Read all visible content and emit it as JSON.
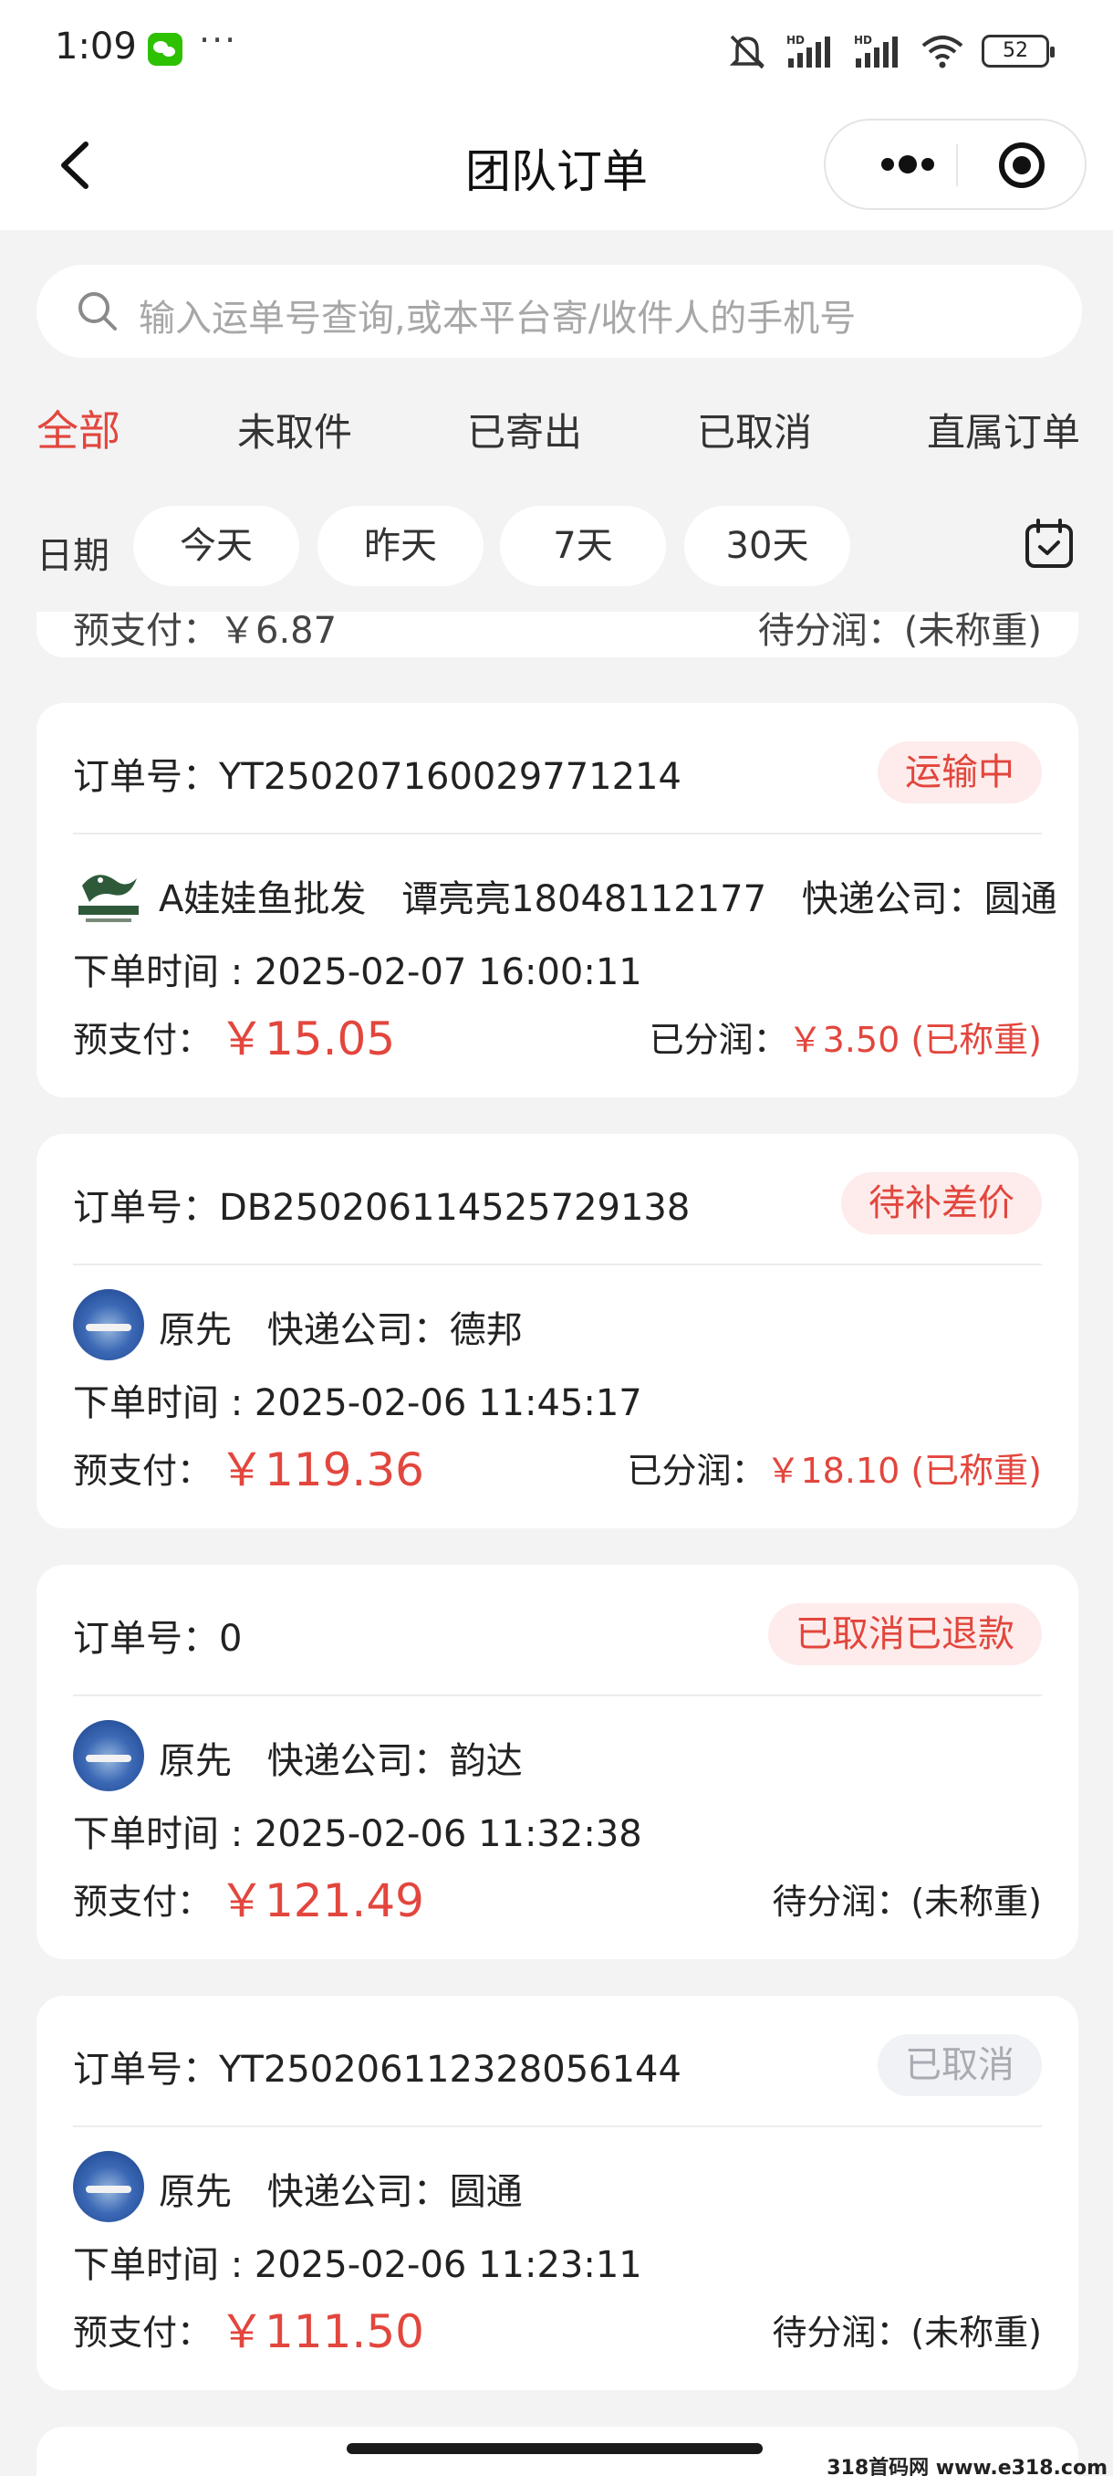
{
  "status_bar": {
    "time": "1:09",
    "more": "···",
    "battery": "52",
    "hd": "HD"
  },
  "nav": {
    "title": "团队订单"
  },
  "search": {
    "placeholder": "输入运单号查询,或本平台寄/收件人的手机号"
  },
  "tabs": [
    {
      "label": "全部",
      "active": true
    },
    {
      "label": "未取件",
      "active": false
    },
    {
      "label": "已寄出",
      "active": false
    },
    {
      "label": "已取消",
      "active": false
    },
    {
      "label": "直属订单",
      "active": false
    }
  ],
  "date_filter": {
    "label": "日期",
    "chips": [
      "今天",
      "昨天",
      "7天",
      "30天"
    ]
  },
  "partial_card": {
    "left": "预支付：￥6.87",
    "right": "待分润：(未称重)"
  },
  "labels": {
    "order_no": "订单号：",
    "time": "下单时间 : ",
    "prepay": "预支付：",
    "courier": "快递公司："
  },
  "orders": [
    {
      "order_no": "YT250207160029771214",
      "status": "运输中",
      "status_style": "red",
      "avatar_type": "logo",
      "user": "A娃娃鱼批发",
      "extra": "谭亮亮18048112177",
      "courier": "圆通",
      "time": "2025-02-07 16:00:11",
      "amount": "￥15.05",
      "share_label": "已分润：",
      "share_value": "￥3.50 (已称重)"
    },
    {
      "order_no": "DB250206114525729138",
      "status": "待补差价",
      "status_style": "red",
      "avatar_type": "photo",
      "user": "原先",
      "extra": "",
      "courier": "德邦",
      "time": "2025-02-06 11:45:17",
      "amount": "￥119.36",
      "share_label": "已分润：",
      "share_value": "￥18.10 (已称重)"
    },
    {
      "order_no": "0",
      "status": "已取消已退款",
      "status_style": "red",
      "avatar_type": "photo",
      "user": "原先",
      "extra": "",
      "courier": "韵达",
      "time": "2025-02-06 11:32:38",
      "amount": "￥121.49",
      "share_label": "待分润：(未称重)",
      "share_value": ""
    },
    {
      "order_no": "YT250206112328056144",
      "status": "已取消",
      "status_style": "grey",
      "avatar_type": "photo",
      "user": "原先",
      "extra": "",
      "courier": "圆通",
      "time": "2025-02-06 11:23:11",
      "amount": "￥111.50",
      "share_label": "待分润：(未称重)",
      "share_value": ""
    }
  ],
  "watermark": "318首码网 www.e318.com"
}
